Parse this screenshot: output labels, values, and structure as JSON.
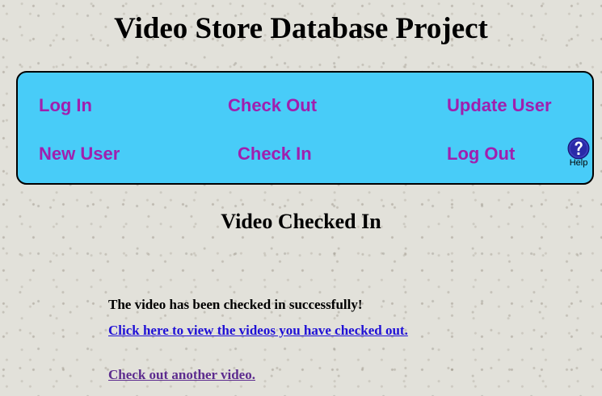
{
  "header": {
    "title": "Video Store Database Project"
  },
  "nav": {
    "log_in": "Log In",
    "check_out": "Check Out",
    "update_user": "Update User",
    "new_user": "New User",
    "check_in": "Check In",
    "log_out": "Log Out",
    "help_label": "Help",
    "help_icon": "question-mark"
  },
  "main": {
    "heading": "Video Checked In",
    "message": "The video has been checked in successfully!",
    "view_checked_out_link": "Click here to view the videos you have checked out.",
    "check_out_another_link": "Check out another video."
  },
  "colors": {
    "nav_background": "#48ccf8",
    "nav_link": "#a01fae",
    "link": "#1f10d6",
    "visited_link": "#5c2b8e",
    "help_icon": "#2a2aa8"
  }
}
